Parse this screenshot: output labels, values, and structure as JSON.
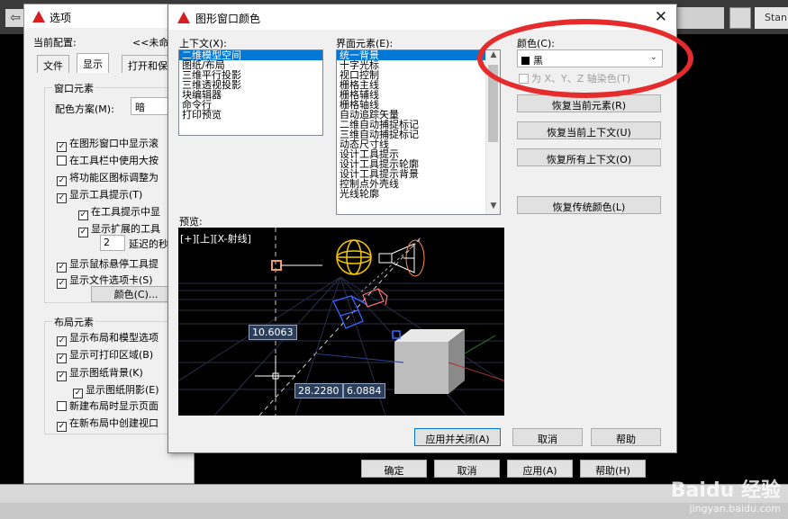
{
  "app": {
    "back_arrow": "⇦",
    "toolbar_text": "Stan",
    "watermark_main": "Baidu 经验",
    "watermark_url": "jingyan.baidu.com"
  },
  "options_dialog": {
    "title": "选项",
    "current_profile_label": "当前配置:",
    "current_profile_value": "<<未命名",
    "tabs": [
      "文件",
      "显示",
      "打开和保"
    ],
    "window_elements_title": "窗口元素",
    "color_scheme_label": "配色方案(M):",
    "color_scheme_value": "暗",
    "checkboxes": [
      {
        "label": "在图形窗口中显示滚",
        "checked": true
      },
      {
        "label": "在工具栏中使用大按",
        "checked": false
      },
      {
        "label": "将功能区图标调整为",
        "checked": true
      },
      {
        "label": "显示工具提示(T)",
        "checked": true
      },
      {
        "label": "在工具提示中显",
        "checked": true
      },
      {
        "label": "显示扩展的工具",
        "checked": true
      }
    ],
    "delay_value": "2",
    "delay_label": "延迟的秒",
    "checkboxes2": [
      {
        "label": "显示鼠标悬停工具提",
        "checked": true
      },
      {
        "label": "显示文件选项卡(S)",
        "checked": true
      }
    ],
    "colors_button": "颜色(C)...",
    "layout_elements_title": "布局元素",
    "layout_checkboxes": [
      {
        "label": "显示布局和模型选项",
        "checked": true
      },
      {
        "label": "显示可打印区域(B)",
        "checked": true
      },
      {
        "label": "显示图纸背景(K)",
        "checked": true
      },
      {
        "label": "显示图纸阴影(E)",
        "checked": true
      },
      {
        "label": "新建布局时显示页面",
        "checked": false
      },
      {
        "label": "在新布局中创建视口",
        "checked": true
      }
    ],
    "ok_button": "确定",
    "cancel_button": "取消",
    "apply_button": "应用(A)",
    "help_button": "帮助(H)"
  },
  "color_dialog": {
    "title": "图形窗口颜色",
    "context_label": "上下文(X):",
    "context_items": [
      "二维模型空间",
      "图纸/布局",
      "三维平行投影",
      "三维透视投影",
      "块编辑器",
      "命令行",
      "打印预览"
    ],
    "context_selected_index": 0,
    "interface_label": "界面元素(E):",
    "interface_items": [
      "统一背景",
      "十字光标",
      "视口控制",
      "栅格主线",
      "栅格辅线",
      "栅格轴线",
      "自动追踪矢量",
      "二维自动捕捉标记",
      "三维自动捕捉标记",
      "动态尺寸线",
      "设计工具提示",
      "设计工具提示轮廓",
      "设计工具提示背景",
      "控制点外壳线",
      "光线轮廓"
    ],
    "interface_selected_index": 0,
    "color_label": "颜色(C):",
    "color_value": "黑",
    "tint_label": "为 X、Y、Z 轴染色(T)",
    "restore_current_element": "恢复当前元素(R)",
    "restore_current_context": "恢复当前上下文(U)",
    "restore_all_contexts": "恢复所有上下文(O)",
    "restore_classic": "恢复传统颜色(L)",
    "preview_label": "预览:",
    "viewport_label": "[+][上][X-射线]",
    "dim_values": [
      "10.6063",
      "28.2280",
      "6.0884"
    ],
    "apply_close_button": "应用并关闭(A)",
    "cancel_button": "取消",
    "help_button": "帮助"
  },
  "colors": {
    "selection": "#0078d7",
    "annotation": "#e52b2b"
  }
}
